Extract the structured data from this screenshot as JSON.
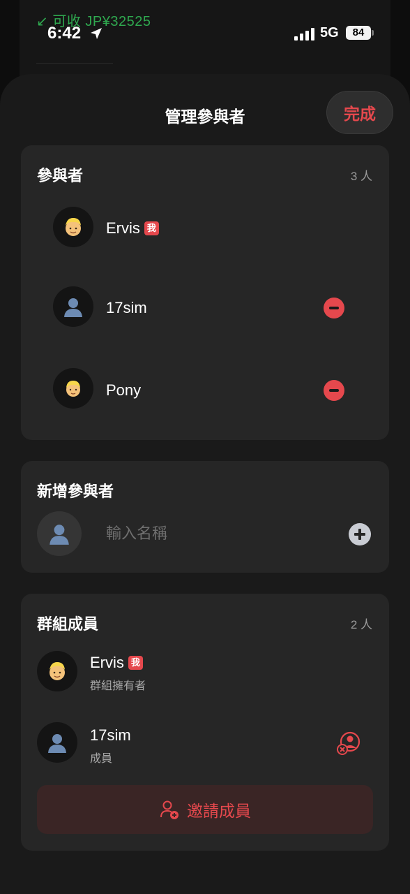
{
  "background": {
    "peek_text": "↙ 可收 JP¥32525"
  },
  "status_bar": {
    "time": "6:42",
    "network": "5G",
    "battery": "84"
  },
  "sheet": {
    "title": "管理參與者",
    "done_label": "完成"
  },
  "participants": {
    "title": "參與者",
    "count": "3 人",
    "items": [
      {
        "name": "Ervis",
        "badge": "我",
        "avatar": "blond-man-icon"
      },
      {
        "name": "17sim",
        "avatar": "person-silhouette-icon"
      },
      {
        "name": "Pony",
        "avatar": "blond-boy-icon"
      }
    ]
  },
  "add_participant": {
    "title": "新增參與者",
    "placeholder": "輸入名稱"
  },
  "group_members": {
    "title": "群組成員",
    "count": "2 人",
    "items": [
      {
        "name": "Ervis",
        "badge": "我",
        "role": "群組擁有者",
        "avatar": "blond-man-icon"
      },
      {
        "name": "17sim",
        "role": "成員",
        "avatar": "person-silhouette-icon"
      }
    ],
    "invite_label": "邀請成員"
  },
  "colors": {
    "accent": "#e5484d",
    "card": "#262626",
    "sheet": "#1a1a1a"
  }
}
